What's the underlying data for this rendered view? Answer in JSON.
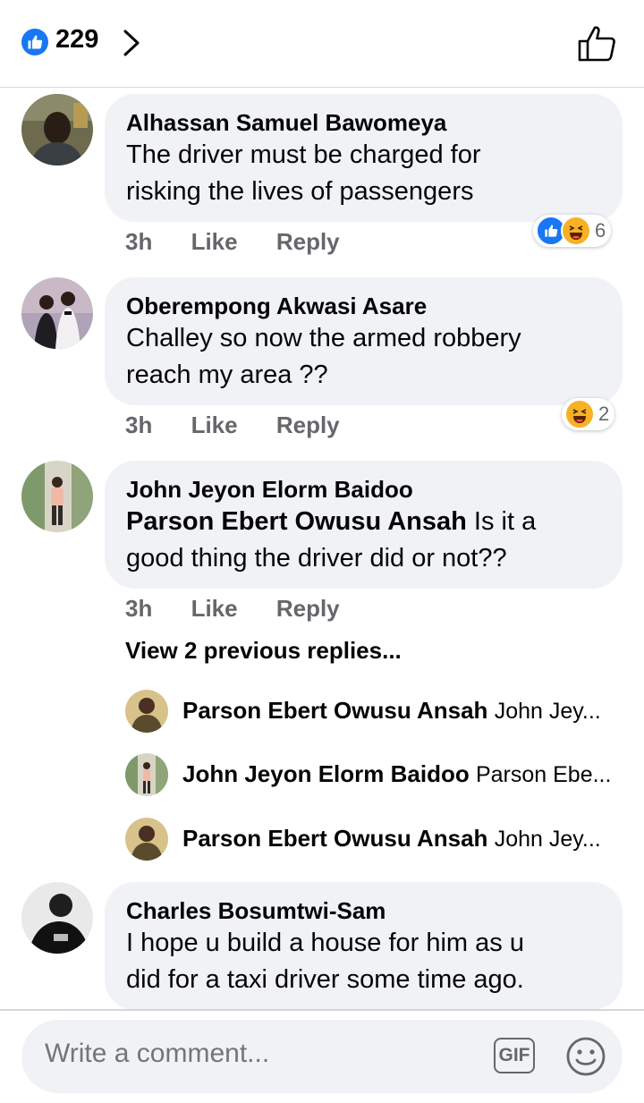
{
  "header": {
    "reaction_count": "229"
  },
  "comments": [
    {
      "author": "Alhassan Samuel Bawomeya",
      "text_lines": [
        "The driver must be charged for",
        "risking the lives of passengers"
      ],
      "time": "3h",
      "like": "Like",
      "reply": "Reply",
      "reaction_count": "6"
    },
    {
      "author": "Oberempong Akwasi Asare",
      "text_lines": [
        "Challey so now the armed robbery",
        "reach my area ??"
      ],
      "time": "3h",
      "like": "Like",
      "reply": "Reply",
      "reaction_count": "2"
    },
    {
      "author": "John Jeyon Elorm Baidoo",
      "mention": "Parson Ebert Owusu Ansah",
      "text_after_mention": " Is it a",
      "text_line2": "good thing the driver did or not??",
      "time": "3h",
      "like": "Like",
      "reply": "Reply"
    },
    {
      "author": "Charles Bosumtwi-Sam",
      "text_lines": [
        "I hope u build a house for him as u",
        "did for a taxi driver some time ago."
      ]
    }
  ],
  "view_previous": "View 2 previous replies...",
  "replies": [
    {
      "name": "Parson Ebert Owusu Ansah",
      "snippet": "John Jey..."
    },
    {
      "name": "John Jeyon Elorm Baidoo",
      "snippet": "Parson Ebe..."
    },
    {
      "name": "Parson Ebert Owusu Ansah",
      "snippet": "John Jey..."
    }
  ],
  "composer": {
    "placeholder": "Write a comment...",
    "gif_label": "GIF"
  },
  "colors": {
    "brand_blue": "#1877f2",
    "bubble_bg": "#f0f2f5",
    "meta_gray": "#65676b"
  }
}
